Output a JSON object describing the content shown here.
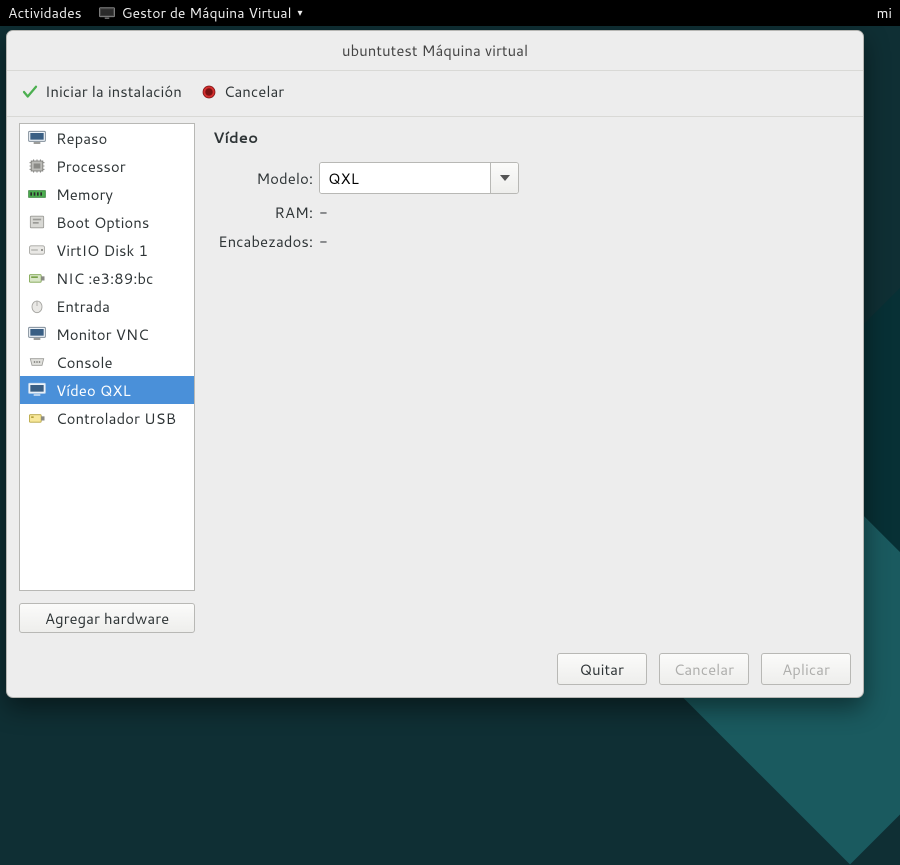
{
  "gnome": {
    "activities": "Actividades",
    "app_menu": "Gestor de Máquina Virtual",
    "right": "mi"
  },
  "window": {
    "title": "ubuntutest Máquina virtual"
  },
  "toolbar": {
    "begin_install": "Iniciar la instalación",
    "cancel": "Cancelar"
  },
  "sidebar": {
    "items": [
      {
        "key": "overview",
        "label": "Repaso"
      },
      {
        "key": "processor",
        "label": "Processor"
      },
      {
        "key": "memory",
        "label": "Memory"
      },
      {
        "key": "boot",
        "label": "Boot Options"
      },
      {
        "key": "disk",
        "label": "VirtIO Disk 1"
      },
      {
        "key": "nic",
        "label": "NIC :e3:89:bc"
      },
      {
        "key": "input",
        "label": "Entrada"
      },
      {
        "key": "monitor",
        "label": "Monitor VNC"
      },
      {
        "key": "console",
        "label": "Console"
      },
      {
        "key": "video",
        "label": "Vídeo QXL"
      },
      {
        "key": "usb",
        "label": "Controlador USB"
      }
    ],
    "selected": "video",
    "add_hardware": "Agregar hardware"
  },
  "detail": {
    "heading": "Vídeo",
    "model_label": "Modelo:",
    "model_value": "QXL",
    "ram_label": "RAM:",
    "ram_value": "-",
    "heads_label": "Encabezados:",
    "heads_value": "-"
  },
  "footer": {
    "remove": "Quitar",
    "cancel": "Cancelar",
    "apply": "Aplicar"
  }
}
